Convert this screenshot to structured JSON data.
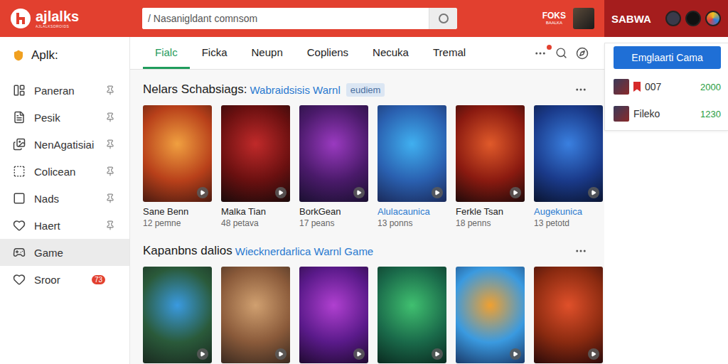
{
  "header": {
    "logo": "ajlalks",
    "logo_tagline": "AJLALKSDROIDS",
    "search": {
      "placeholder": "/ Nasanigldant comnsom"
    },
    "user": {
      "name": "FOKS",
      "subtitle": "BAALKA"
    },
    "account": {
      "label": "SABWA"
    }
  },
  "sidebar": {
    "title": "Aplk:",
    "items": [
      {
        "label": "Paneran",
        "pinned": true,
        "selected": false
      },
      {
        "label": "Pesik",
        "pinned": true,
        "selected": false
      },
      {
        "label": "NenAgatisiai",
        "pinned": true,
        "selected": false
      },
      {
        "label": "Colicean",
        "pinned": true,
        "selected": false
      },
      {
        "label": "Nads",
        "pinned": true,
        "selected": false
      },
      {
        "label": "Haert",
        "pinned": true,
        "selected": false
      },
      {
        "label": "Game",
        "pinned": false,
        "selected": true
      },
      {
        "label": "Sroor",
        "pinned": false,
        "selected": false,
        "badge": "73"
      }
    ]
  },
  "tabs": [
    {
      "label": "Fialc",
      "selected": true
    },
    {
      "label": "Ficka",
      "selected": false
    },
    {
      "label": "Neupn",
      "selected": false
    },
    {
      "label": "Copliens",
      "selected": false
    },
    {
      "label": "Necuka",
      "selected": false
    },
    {
      "label": "Tremal",
      "selected": false
    }
  ],
  "sections": [
    {
      "title": "Nelars Schabsiags:",
      "subtitle": "Wabraidsisis Warnl",
      "badge": "eudiem",
      "cards": [
        {
          "title": "Sane Benn",
          "count": "12 pemne",
          "link": false
        },
        {
          "title": "Malka Tian",
          "count": "48 petava",
          "link": false
        },
        {
          "title": "BorkGean",
          "count": "17 peans",
          "link": false
        },
        {
          "title": "Alulacaunica",
          "count": "13 ponns",
          "link": true
        },
        {
          "title": "Ferkle Tsan",
          "count": "18 penns",
          "link": false
        },
        {
          "title": "Augekunica",
          "count": "13 petotd",
          "link": true
        }
      ]
    },
    {
      "title": "Kapanbns dalios",
      "subtitle": "Wiecknerdarlica Warnl Game",
      "cards": [
        {},
        {},
        {},
        {},
        {},
        {}
      ]
    }
  ],
  "right_panel": {
    "button": "Emglaarti Cama",
    "rows": [
      {
        "name": "007",
        "value": "2000",
        "kind": "tag"
      },
      {
        "name": "Fileko",
        "value": "1230",
        "kind": "plain"
      }
    ]
  }
}
